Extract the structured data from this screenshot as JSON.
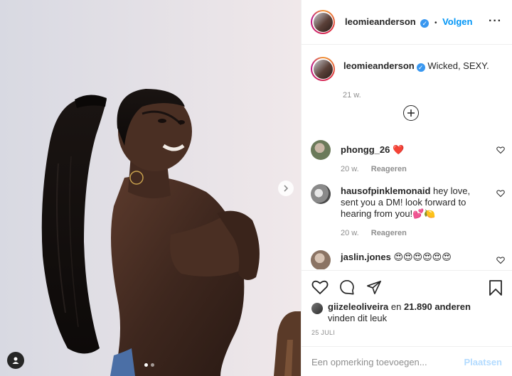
{
  "post": {
    "image_alt": "",
    "carousel": {
      "count": 2,
      "active_index": 0
    }
  },
  "header": {
    "username": "leomieanderson",
    "verified_mark": "✓",
    "separator": "•",
    "follow_label": "Volgen",
    "more_icon": "more-horizontal-icon"
  },
  "caption": {
    "username": "leomieanderson",
    "text": "Wicked, SEXY.",
    "time": "21 w."
  },
  "load_more_icon": "plus-circle-icon",
  "comments": [
    {
      "username": "phongg_26",
      "text": "❤️",
      "time": "20 w.",
      "reply_label": "Reageren",
      "avatar_color": "#6b7a5a"
    },
    {
      "username": "hausofpinklemonaid",
      "text": "hey love, sent you a DM! look forward to hearing from you!💕🍋",
      "time": "20 w.",
      "reply_label": "Reageren",
      "avatar_color": "#9a9a9a"
    },
    {
      "username": "jaslin.jones",
      "text": "😍😍😍😍😍😍",
      "time": "",
      "reply_label": "",
      "avatar_color": "#b7a89c"
    }
  ],
  "actions": {
    "icons": [
      "heart-icon",
      "comment-icon",
      "share-icon",
      "bookmark-icon"
    ]
  },
  "likes": {
    "username": "giizeleoliveira",
    "joiner": " en ",
    "count_text": "21.890 anderen",
    "suffix": " vinden dit leuk"
  },
  "date": "25 JULI",
  "add_comment": {
    "placeholder": "Een opmerking toevoegen...",
    "post_label": "Plaatsen"
  },
  "colors": {
    "accent": "#0095f6",
    "text": "#262626",
    "secondary": "#8e8e8e",
    "post_disabled": "#b3dbff"
  }
}
